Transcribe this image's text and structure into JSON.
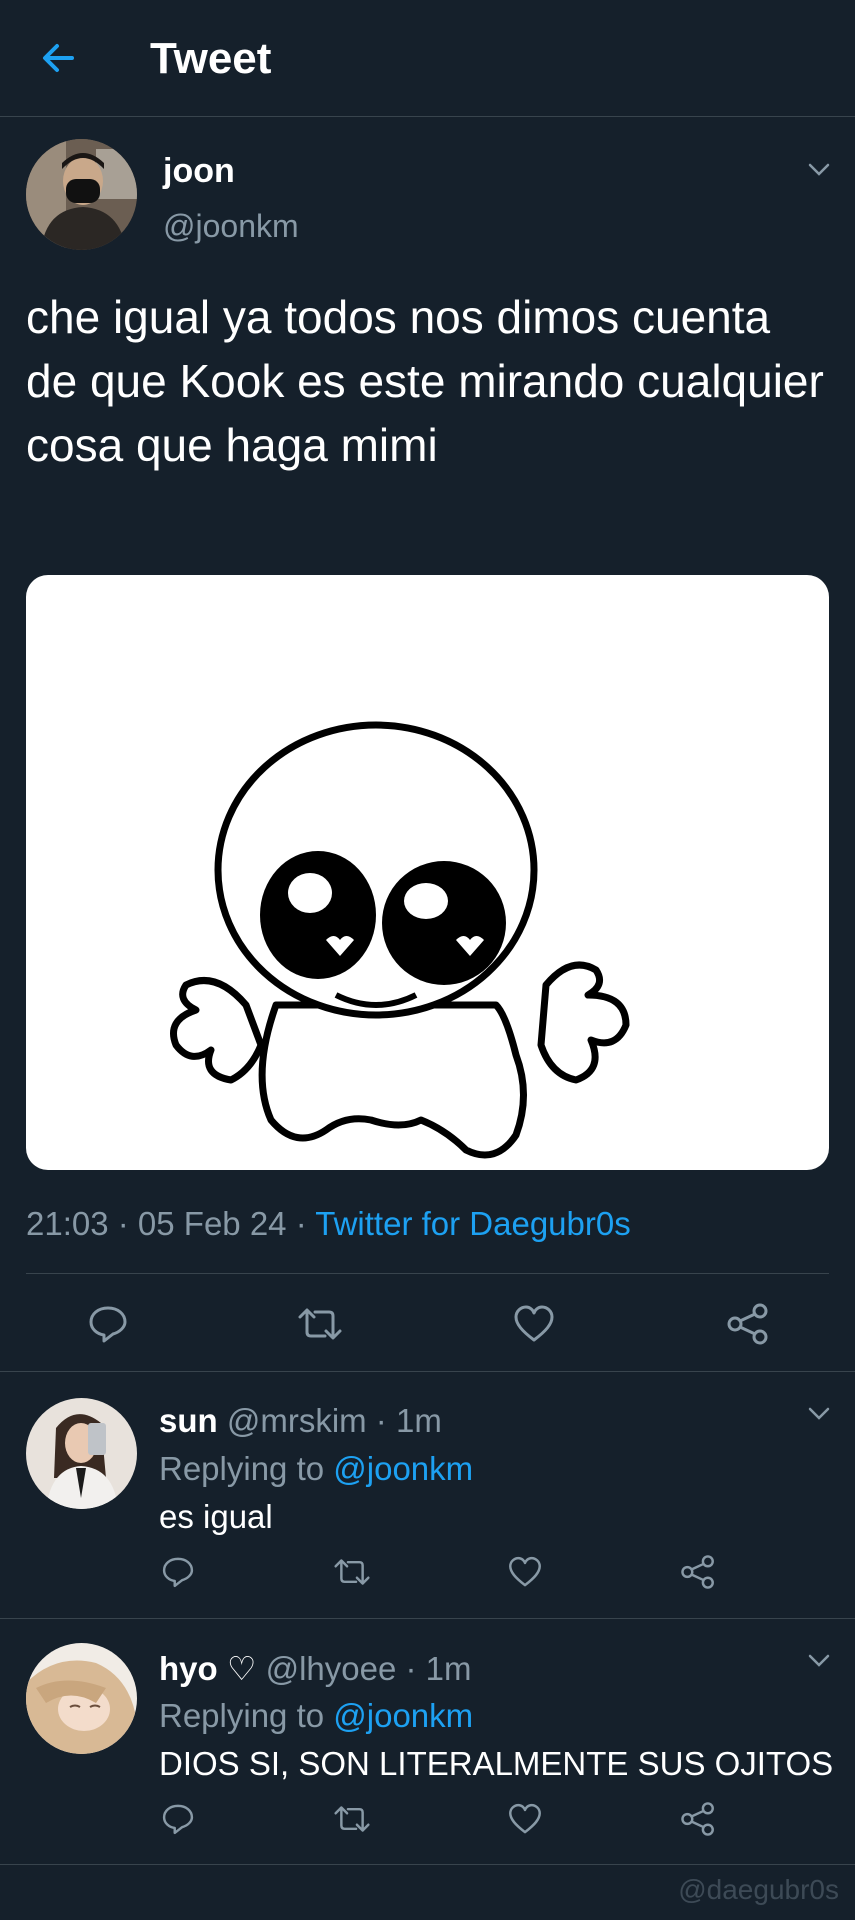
{
  "header": {
    "title": "Tweet",
    "back_icon": "arrow-left-icon",
    "accent": "#1da1f2"
  },
  "tweet": {
    "name": "joon",
    "handle": "@joonkm",
    "text": "che igual ya todos nos dimos cuenta de que Kook es este mirando cualquier cosa que haga mimi",
    "time": "21:03 · 05 Feb 24 · ",
    "source": "Twitter for Daegubr0s",
    "media_description_icon": "cartoon-big-eyes-icon"
  },
  "actions": {
    "reply_icon": "reply-icon",
    "retweet_icon": "retweet-icon",
    "like_icon": "heart-icon",
    "share_icon": "share-icon"
  },
  "replies": [
    {
      "name": "sun",
      "meta": " @mrskim · 1m",
      "replying_prefix": "Replying to ",
      "replying_to": "@joonkm",
      "text": "es igual"
    },
    {
      "name": "hyo ♡",
      "meta": " @lhyoee · 1m",
      "replying_prefix": "Replying to ",
      "replying_to": "@joonkm",
      "text": "DIOS SI, SON LITERALMENTE SUS OJITOS"
    }
  ],
  "watermark": "@daegubr0s",
  "colors": {
    "background": "#15202b",
    "muted": "#8899a6",
    "link": "#1da1f2",
    "border": "#38444d"
  }
}
